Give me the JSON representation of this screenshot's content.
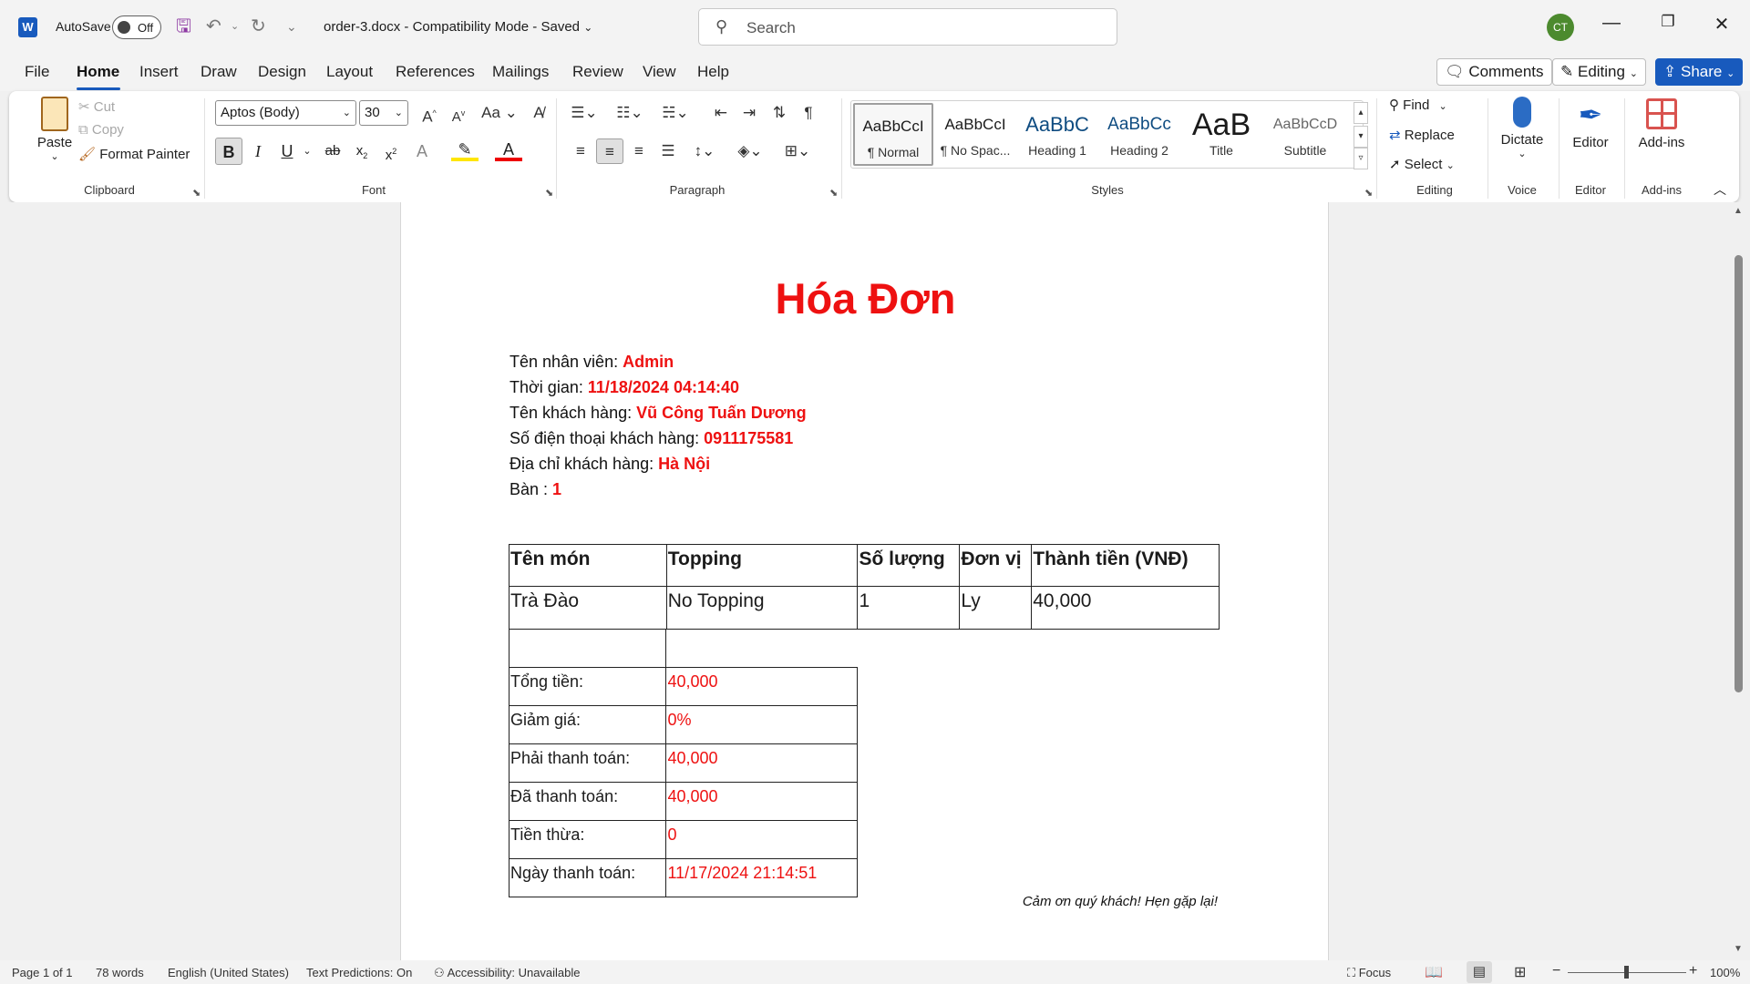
{
  "titlebar": {
    "app_logo": "W",
    "autosave_label": "AutoSave",
    "autosave_state": "Off",
    "filename": "order-3.docx",
    "separator": "-",
    "mode": "Compatibility Mode",
    "save_status": "Saved",
    "search_placeholder": "Search",
    "user_initials": "CT"
  },
  "tabs": [
    "File",
    "Home",
    "Insert",
    "Draw",
    "Design",
    "Layout",
    "References",
    "Mailings",
    "Review",
    "View",
    "Help"
  ],
  "active_tab": "Home",
  "top_right": {
    "comments": "Comments",
    "editing": "Editing",
    "share": "Share"
  },
  "ribbon": {
    "clipboard": {
      "paste": "Paste",
      "cut": "Cut",
      "copy": "Copy",
      "format_painter": "Format Painter",
      "label": "Clipboard"
    },
    "font": {
      "name": "Aptos (Body)",
      "size": "30",
      "label": "Font"
    },
    "paragraph": {
      "label": "Paragraph"
    },
    "styles": {
      "label": "Styles",
      "items": [
        {
          "preview": "AaBbCcI",
          "name": "¶ Normal"
        },
        {
          "preview": "AaBbCcI",
          "name": "¶ No Spac..."
        },
        {
          "preview": "AaBbC",
          "name": "Heading 1"
        },
        {
          "preview": "AaBbCc",
          "name": "Heading 2"
        },
        {
          "preview": "AaB",
          "name": "Title"
        },
        {
          "preview": "AaBbCcD",
          "name": "Subtitle"
        }
      ]
    },
    "editing": {
      "find": "Find",
      "replace": "Replace",
      "select": "Select",
      "label": "Editing"
    },
    "voice": {
      "dictate": "Dictate",
      "label": "Voice"
    },
    "editor": {
      "editor": "Editor",
      "label": "Editor"
    },
    "addins": {
      "addins": "Add-ins",
      "label": "Add-ins"
    }
  },
  "document": {
    "title": "Hóa Đơn",
    "info": [
      {
        "label": "Tên nhân viên: ",
        "value": "Admin"
      },
      {
        "label": "Thời gian: ",
        "value": "11/18/2024 04:14:40"
      },
      {
        "label": "Tên khách hàng: ",
        "value": "Vũ Công Tuấn Dương"
      },
      {
        "label": "Số điện thoại khách hàng: ",
        "value": "0911175581"
      },
      {
        "label": "Địa chỉ khách hàng: ",
        "value": "Hà Nội"
      },
      {
        "label": "Bàn : ",
        "value": "1"
      }
    ],
    "items_table": {
      "headers": [
        "Tên món",
        "Topping",
        "Số lượng",
        "Đơn vị",
        "Thành tiền (VNĐ)"
      ],
      "rows": [
        [
          "Trà Đào",
          "No Topping",
          "1",
          "Ly",
          "40,000"
        ]
      ]
    },
    "summary": [
      {
        "label": "Tổng tiền:",
        "value": "40,000"
      },
      {
        "label": "Giảm giá:",
        "value": "0%"
      },
      {
        "label": "Phải thanh toán:",
        "value": "40,000"
      },
      {
        "label": "Đã thanh toán:",
        "value": "40,000"
      },
      {
        "label": "Tiền thừa:",
        "value": "0"
      },
      {
        "label": "Ngày thanh toán:",
        "value": "11/17/2024 21:14:51"
      }
    ],
    "thanks": "Cảm ơn quý khách! Hẹn gặp lại!"
  },
  "statusbar": {
    "page": "Page 1 of 1",
    "words": "78 words",
    "language": "English (United States)",
    "predictions": "Text Predictions: On",
    "accessibility": "Accessibility: Unavailable",
    "focus": "Focus",
    "zoom": "100%"
  }
}
